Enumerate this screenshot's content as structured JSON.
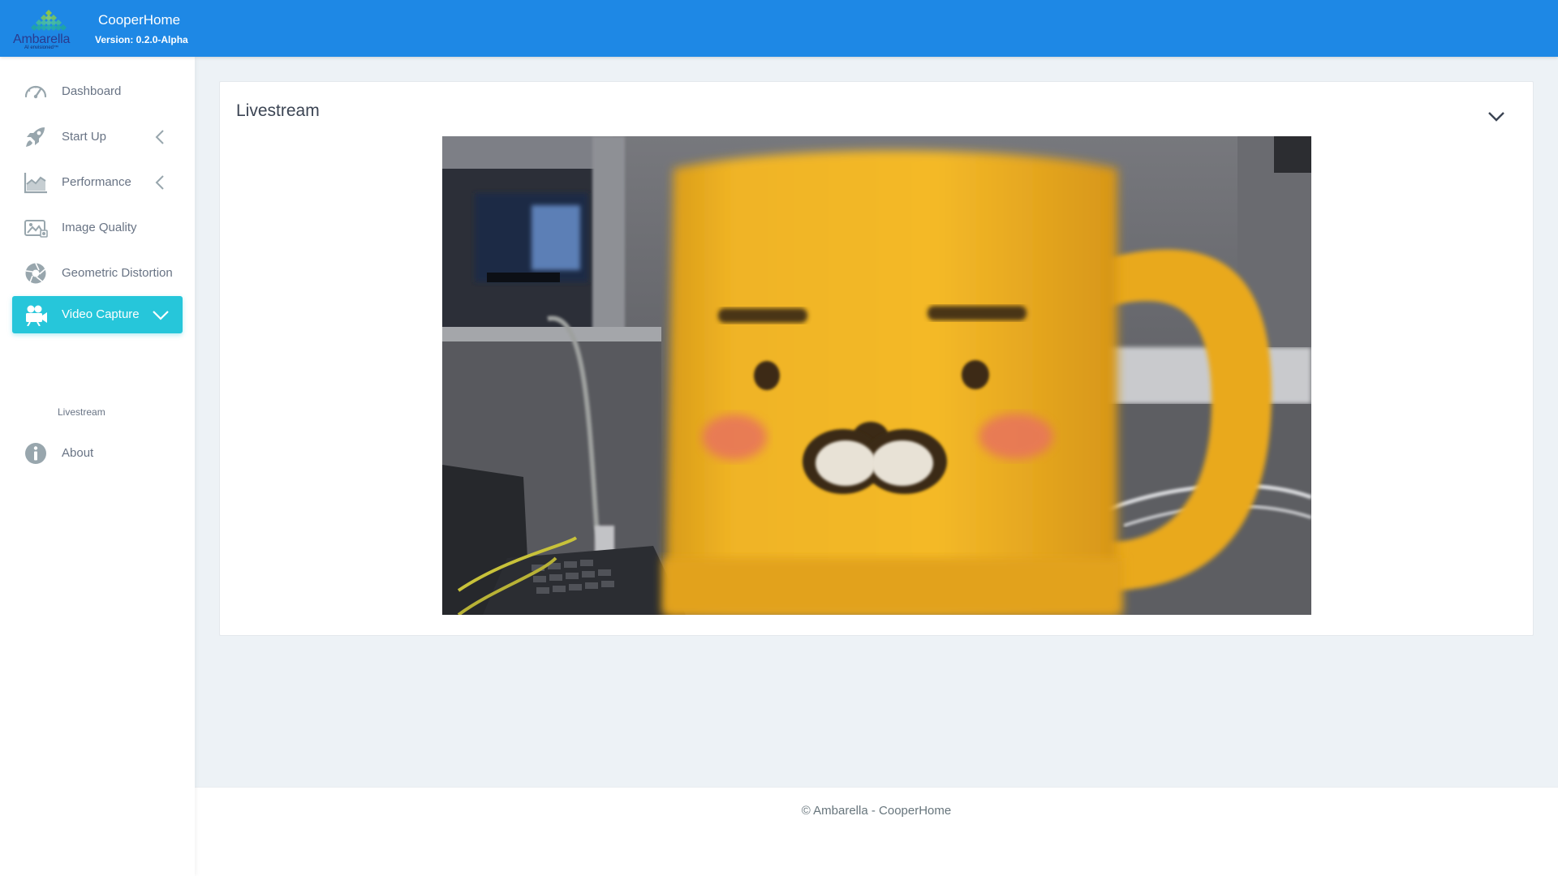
{
  "header": {
    "brand_name": "Ambarella",
    "brand_tagline": "AI envisioned™",
    "app_name": "CooperHome",
    "version": "Version: 0.2.0-Alpha"
  },
  "sidebar": {
    "items": [
      {
        "label": "Dashboard",
        "icon": "speedometer-icon"
      },
      {
        "label": "Start Up",
        "icon": "rocket-icon",
        "expandable": true,
        "expanded": false
      },
      {
        "label": "Performance",
        "icon": "area-chart-icon",
        "expandable": true,
        "expanded": false
      },
      {
        "label": "Image Quality",
        "icon": "image-icon"
      },
      {
        "label": "Geometric Distortion",
        "icon": "camera-aperture-icon"
      },
      {
        "label": "Video Capture",
        "icon": "video-camera-icon",
        "expandable": true,
        "expanded": true,
        "active": true,
        "children": [
          {
            "label": "Livestream"
          }
        ]
      },
      {
        "label": "About",
        "icon": "info-icon"
      }
    ]
  },
  "main": {
    "card_title": "Livestream",
    "collapse_icon": "chevron-down-icon",
    "video_alt": "Livestream camera feed"
  },
  "footer": {
    "text": "© Ambarella - CooperHome"
  },
  "colors": {
    "header": "#1e88e5",
    "active": "#26c6da",
    "background": "#edf2f6"
  }
}
